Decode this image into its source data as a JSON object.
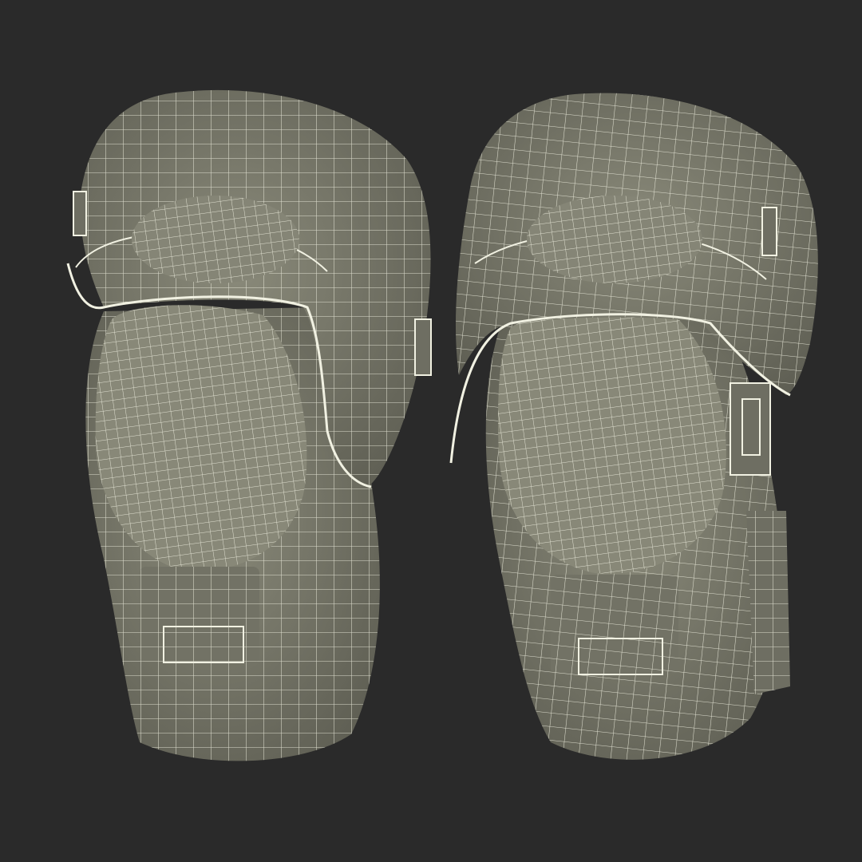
{
  "scene": {
    "background_color": "#2a2a2a",
    "model_fill": "#7b7b6c",
    "model_shadow": "#5f5f54",
    "model_highlight": "#8e8e7e",
    "wire_color": "#f1f1e2",
    "objects": [
      "left-knee-pad",
      "right-knee-pad"
    ]
  }
}
